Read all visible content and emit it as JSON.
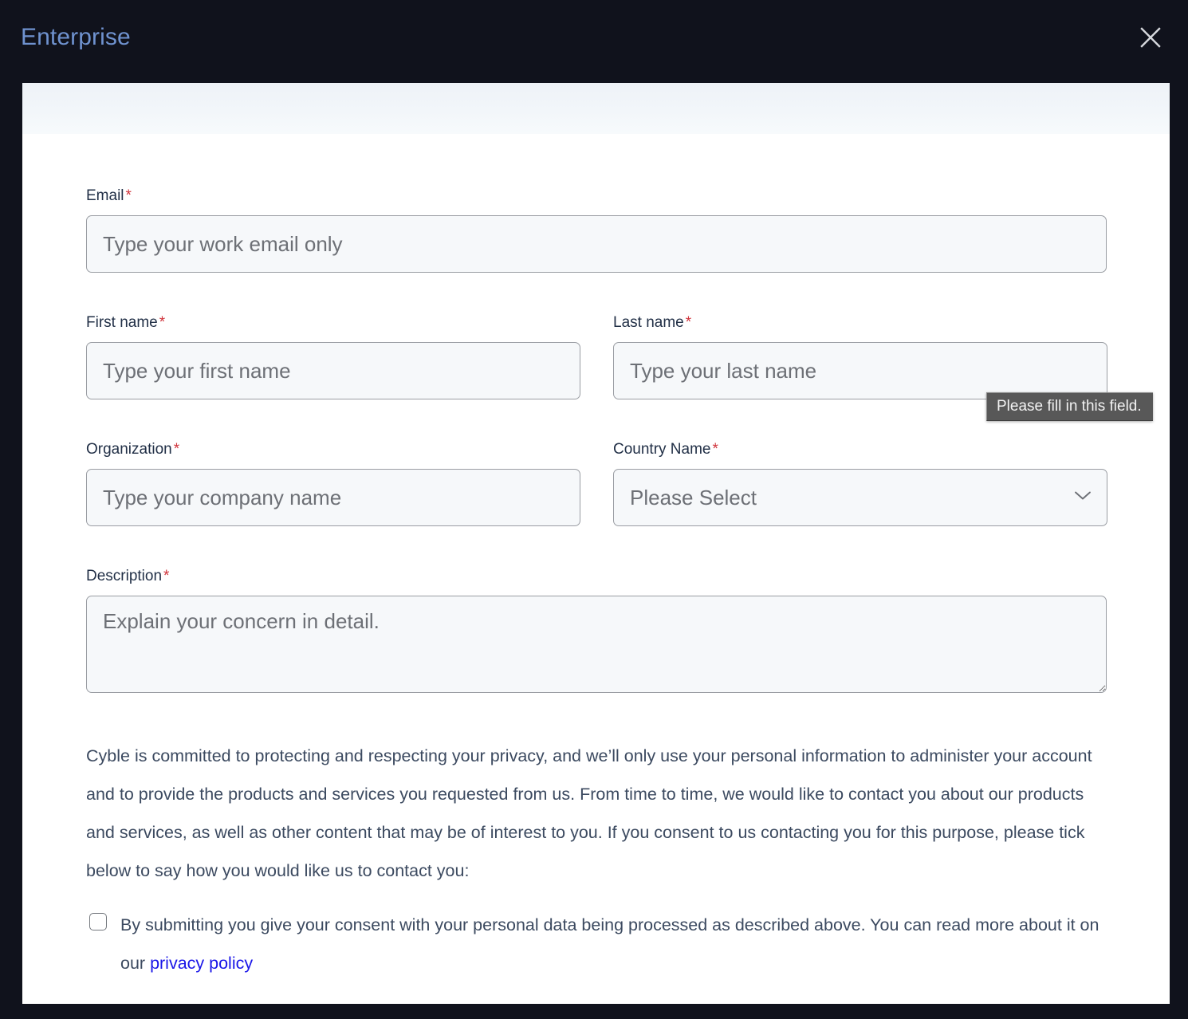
{
  "header": {
    "title": "Enterprise",
    "close_icon": "close-icon"
  },
  "form": {
    "email": {
      "label": "Email",
      "required_marker": "*",
      "placeholder": "Type your work email only",
      "value": ""
    },
    "first_name": {
      "label": "First name",
      "required_marker": "*",
      "placeholder": "Type your first name",
      "value": ""
    },
    "last_name": {
      "label": "Last name",
      "required_marker": "*",
      "placeholder": "Type your last name",
      "value": ""
    },
    "organization": {
      "label": "Organization",
      "required_marker": "*",
      "placeholder": "Type your company name",
      "value": ""
    },
    "country": {
      "label": "Country Name",
      "required_marker": "*",
      "selected": "Please Select",
      "caret_icon": "chevron-down-icon"
    },
    "description": {
      "label": "Description",
      "required_marker": "*",
      "placeholder": "Explain your concern in detail.",
      "value": ""
    }
  },
  "privacy": {
    "paragraph": "Cyble is committed to protecting and respecting your privacy, and we’ll only use your personal information to administer your account and to provide the products and services you requested from us. From time to time, we would like to contact you about our products and services, as well as other content that may be of interest to you. If you consent to us contacting you for this purpose, please tick below to say how you would like us to contact you:",
    "consent_text_before_link": "By submitting you give your consent with your personal data being processed as described above. You can read more about it on our ",
    "consent_link_label": "privacy policy",
    "consent_checked": false
  },
  "tooltip": {
    "message": "Please fill in this field."
  },
  "colors": {
    "background": "#10121c",
    "panel": "#ffffff",
    "title": "#6f92cf",
    "required_asterisk": "#d0333b",
    "label_text": "#223047",
    "body_text": "#3c4a60",
    "placeholder": "#6d7076",
    "input_fill": "#f6f8fa",
    "input_border": "#9a9da3",
    "link": "#1a16e8",
    "tooltip_background": "#585858",
    "tooltip_text": "#f2f2f2"
  }
}
